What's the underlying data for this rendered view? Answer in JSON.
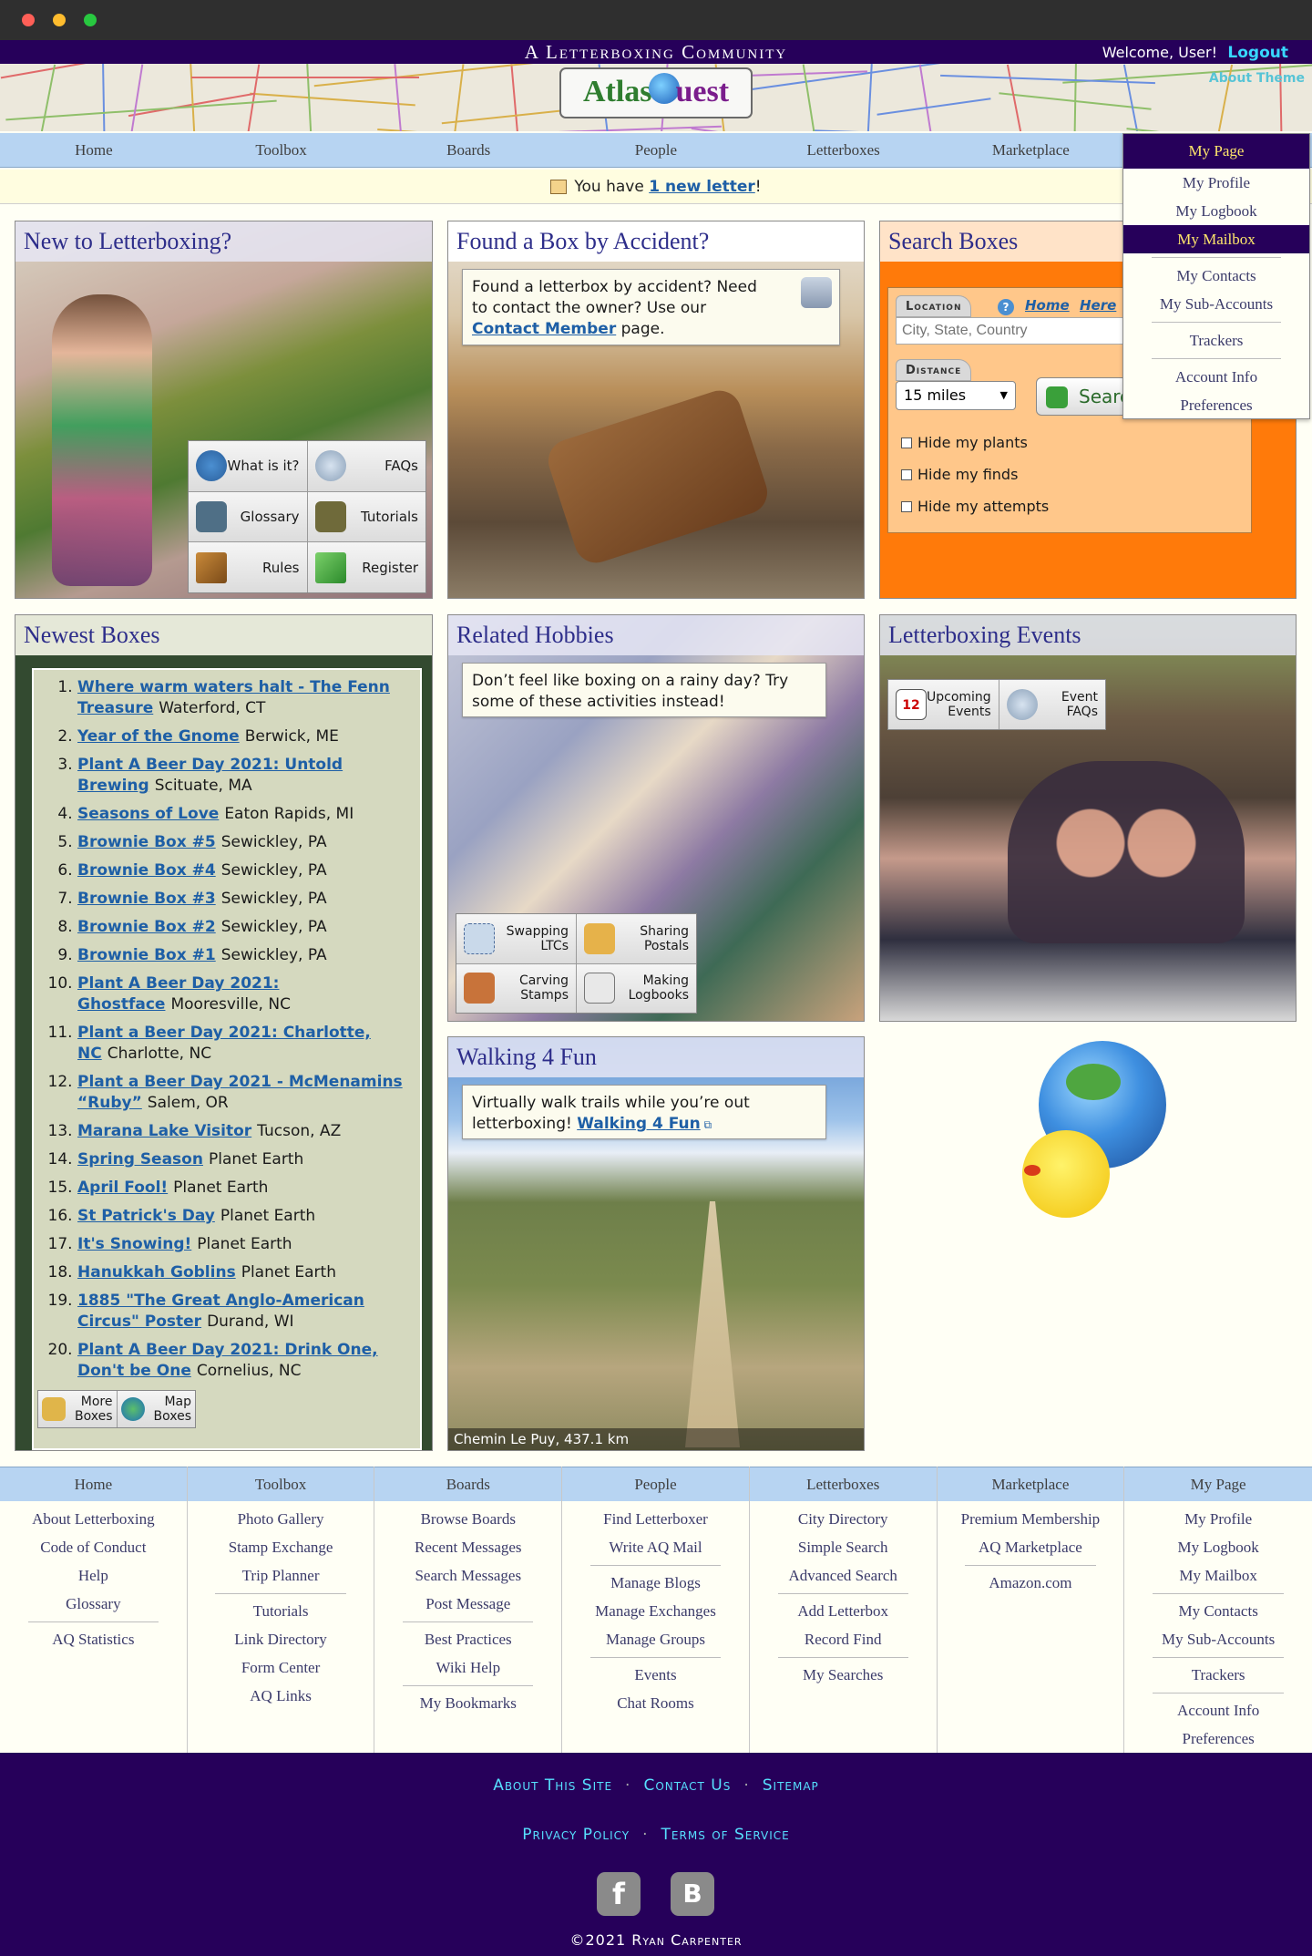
{
  "header": {
    "site_title": "A Letterboxing Community",
    "welcome": "Welcome, User!",
    "logout": "Logout",
    "about_theme": "About Theme",
    "logo_text_left": "Atlas",
    "logo_text_right": "uest"
  },
  "topnav": [
    "Home",
    "Toolbox",
    "Boards",
    "People",
    "Letterboxes",
    "Marketplace",
    "My Page"
  ],
  "mypage_menu": {
    "group1": [
      "My Profile",
      "My Logbook",
      "My Mailbox"
    ],
    "group2": [
      "My Contacts",
      "My Sub-Accounts"
    ],
    "group3": [
      "Trackers"
    ],
    "group4": [
      "Account Info",
      "Preferences"
    ],
    "selected": "My Mailbox"
  },
  "notice": {
    "prefix": "You have ",
    "link": "1 new letter",
    "suffix": "!"
  },
  "new_to": {
    "title": "New to Letterboxing?",
    "buttons": [
      "What is it?",
      "FAQs",
      "Glossary",
      "Tutorials",
      "Rules",
      "Register"
    ]
  },
  "found_box": {
    "title": "Found a Box by Accident?",
    "text": "Found a letterbox by accident? Need to contact the owner? Use our ",
    "link": "Contact Member",
    "suffix": " page."
  },
  "search": {
    "title": "Search Boxes",
    "location_label": "Location",
    "home_link": "Home",
    "here_link": "Here",
    "location_placeholder": "City, State, Country",
    "distance_label": "Distance",
    "distance_value": "15 miles",
    "search_button": "Search",
    "checks": [
      "Hide my plants",
      "Hide my finds",
      "Hide my attempts"
    ]
  },
  "newest": {
    "title": "Newest Boxes",
    "items": [
      {
        "name": "Where warm waters halt - The Fenn Treasure",
        "loc": "Waterford, CT"
      },
      {
        "name": "Year of the Gnome",
        "loc": "Berwick, ME"
      },
      {
        "name": "Plant A Beer Day 2021: Untold Brewing",
        "loc": "Scituate, MA"
      },
      {
        "name": "Seasons of Love",
        "loc": "Eaton Rapids, MI"
      },
      {
        "name": "Brownie Box #5",
        "loc": "Sewickley, PA"
      },
      {
        "name": "Brownie Box #4",
        "loc": "Sewickley, PA"
      },
      {
        "name": "Brownie Box #3",
        "loc": "Sewickley, PA"
      },
      {
        "name": "Brownie Box #2",
        "loc": "Sewickley, PA"
      },
      {
        "name": "Brownie Box #1",
        "loc": "Sewickley, PA"
      },
      {
        "name": "Plant A Beer Day 2021: Ghostface",
        "loc": "Mooresville, NC"
      },
      {
        "name": "Plant a Beer Day 2021: Charlotte, NC",
        "loc": "Charlotte, NC"
      },
      {
        "name": "Plant a Beer Day 2021 - McMenamins “Ruby”",
        "loc": "Salem, OR"
      },
      {
        "name": "Marana Lake Visitor",
        "loc": "Tucson, AZ"
      },
      {
        "name": "Spring Season",
        "loc": "Planet Earth"
      },
      {
        "name": "April Fool!",
        "loc": "Planet Earth"
      },
      {
        "name": "St Patrick's Day",
        "loc": "Planet Earth"
      },
      {
        "name": "It's Snowing!",
        "loc": "Planet Earth"
      },
      {
        "name": "Hanukkah Goblins",
        "loc": "Planet Earth"
      },
      {
        "name": "1885 \"The Great Anglo-American Circus\" Poster",
        "loc": "Durand, WI"
      },
      {
        "name": "Plant A Beer Day 2021: Drink One, Don't be One",
        "loc": "Cornelius, NC"
      }
    ],
    "more_boxes": "More Boxes",
    "map_boxes": "Map Boxes"
  },
  "hobbies": {
    "title": "Related Hobbies",
    "text": "Don’t feel like boxing on a rainy day? Try some of these activities instead!",
    "buttons": [
      "Swapping LTCs",
      "Sharing Postals",
      "Carving Stamps",
      "Making Logbooks"
    ]
  },
  "events": {
    "title": "Letterboxing Events",
    "buttons": [
      "Upcoming Events",
      "Event FAQs"
    ],
    "calendar_day": "12"
  },
  "walking": {
    "title": "Walking 4 Fun",
    "text": "Virtually walk trails while you’re out letterboxing! ",
    "link": "Walking 4 Fun",
    "caption": "Chemin Le Puy, 437.1 km"
  },
  "footer_cols": [
    {
      "head": "Home",
      "groups": [
        [
          "About Letterboxing",
          "Code of Conduct",
          "Help",
          "Glossary"
        ],
        [
          "AQ Statistics"
        ]
      ]
    },
    {
      "head": "Toolbox",
      "groups": [
        [
          "Photo Gallery",
          "Stamp Exchange",
          "Trip Planner"
        ],
        [
          "Tutorials",
          "Link Directory",
          "Form Center",
          "AQ Links"
        ]
      ]
    },
    {
      "head": "Boards",
      "groups": [
        [
          "Browse Boards",
          "Recent Messages",
          "Search Messages",
          "Post Message"
        ],
        [
          "Best Practices",
          "Wiki Help"
        ],
        [
          "My Bookmarks"
        ]
      ]
    },
    {
      "head": "People",
      "groups": [
        [
          "Find Letterboxer",
          "Write AQ Mail"
        ],
        [
          "Manage Blogs",
          "Manage Exchanges",
          "Manage Groups"
        ],
        [
          "Events",
          "Chat Rooms"
        ]
      ]
    },
    {
      "head": "Letterboxes",
      "groups": [
        [
          "City Directory",
          "Simple Search",
          "Advanced Search"
        ],
        [
          "Add Letterbox",
          "Record Find"
        ],
        [
          "My Searches"
        ]
      ]
    },
    {
      "head": "Marketplace",
      "groups": [
        [
          "Premium Membership",
          "AQ Marketplace"
        ],
        [
          "Amazon.com"
        ]
      ]
    },
    {
      "head": "My Page",
      "groups": [
        [
          "My Profile",
          "My Logbook",
          "My Mailbox"
        ],
        [
          "My Contacts",
          "My Sub-Accounts"
        ],
        [
          "Trackers"
        ],
        [
          "Account Info",
          "Preferences"
        ]
      ]
    }
  ],
  "bottom": {
    "row1": [
      "About This Site",
      "Contact Us",
      "Sitemap"
    ],
    "row2": [
      "Privacy Policy",
      "Terms of Service"
    ],
    "separator": "·",
    "facebook": "f",
    "blogger": "B",
    "copyright": "©2021 Ryan Carpenter"
  },
  "colors": {
    "purple": "#26005a",
    "nav_blue": "#b7d4f2",
    "link": "#1e5fa6",
    "orange": "#ff7a0a"
  }
}
